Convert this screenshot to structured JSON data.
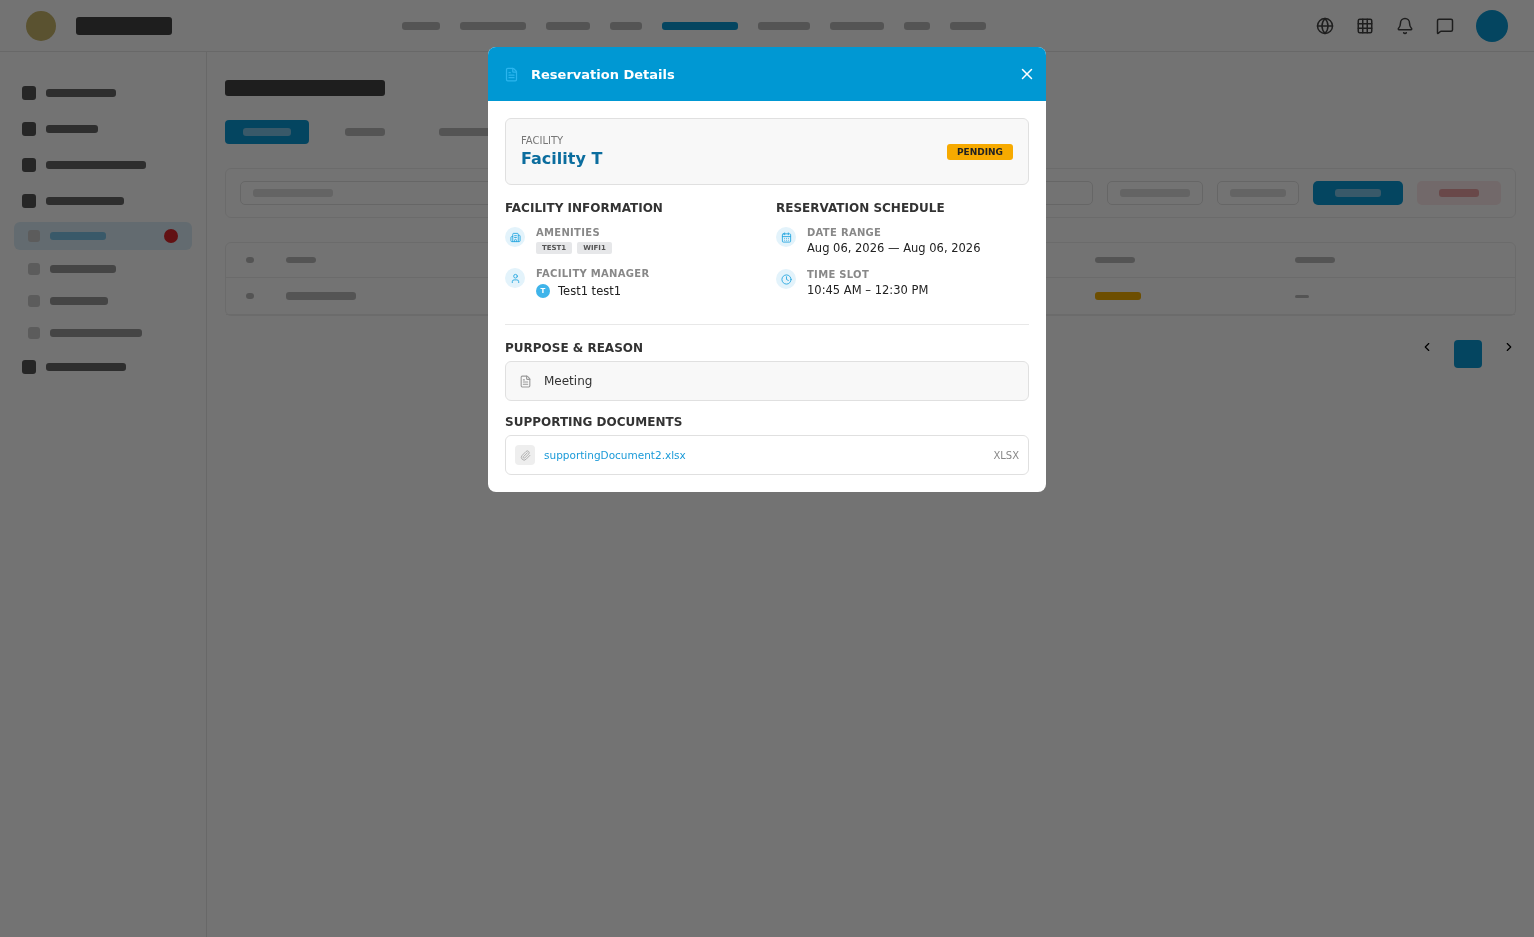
{
  "dialog": {
    "title": "Reservation Details",
    "facility": {
      "label": "FACILITY",
      "name": "Facility T",
      "status": "PENDING"
    },
    "facility_information": {
      "heading": "FACILITY INFORMATION",
      "amenities_label": "AMENITIES",
      "amenities": [
        "TEST1",
        "WIFI1"
      ],
      "manager_label": "FACILITY MANAGER",
      "manager_initial": "T",
      "manager_name": "Test1 test1"
    },
    "reservation_schedule": {
      "heading": "RESERVATION SCHEDULE",
      "date_label": "DATE RANGE",
      "date_value": "Aug 06, 2026 — Aug 06, 2026",
      "time_label": "TIME SLOT",
      "time_value": "10:45 AM – 12:30 PM"
    },
    "purpose": {
      "heading": "PURPOSE & REASON",
      "text": "Meeting"
    },
    "documents": {
      "heading": "SUPPORTING DOCUMENTS",
      "files": [
        {
          "name": "supportingDocument2.xlsx",
          "type": "XLSX"
        }
      ]
    }
  }
}
